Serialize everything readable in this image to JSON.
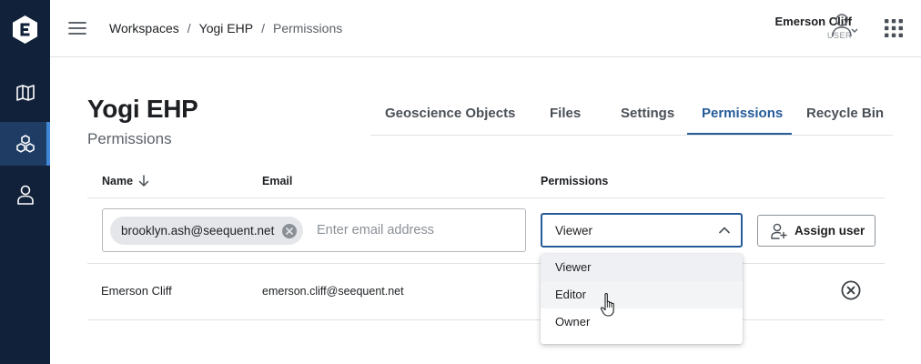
{
  "header": {
    "breadcrumb": [
      "Workspaces",
      "Yogi EHP",
      "Permissions"
    ],
    "separator": "/",
    "user_name": "Emerson Cliff",
    "user_role": "USER"
  },
  "workspace": {
    "title": "Yogi EHP",
    "subtitle": "Permissions"
  },
  "tabs": [
    {
      "label": "Geoscience Objects",
      "active": false
    },
    {
      "label": "Files",
      "active": false
    },
    {
      "label": "Settings",
      "active": false
    },
    {
      "label": "Permissions",
      "active": true
    },
    {
      "label": "Recycle Bin",
      "active": false
    }
  ],
  "table": {
    "columns": [
      "Name",
      "Email",
      "Permissions"
    ],
    "rows": [
      {
        "name": "Emerson Cliff",
        "email": "emerson.cliff@seequent.net"
      }
    ]
  },
  "add_user": {
    "chip": "brooklyn.ash@seequent.net",
    "placeholder": "Enter email address",
    "permission_value": "Viewer",
    "assign_label": "Assign user"
  },
  "dropdown": {
    "options": [
      "Viewer",
      "Editor",
      "Owner"
    ],
    "selected": "Viewer",
    "hovered": "Editor"
  },
  "colors": {
    "sidebar": "#11213a",
    "sidebar_active": "#1f3c64",
    "accent": "#265c99"
  },
  "icons": [
    "logo-icon",
    "map-icon",
    "workspaces-icon",
    "user-icon",
    "hamburger-icon",
    "account-icon",
    "apps-grid-icon",
    "sort-down-icon",
    "chip-remove-icon",
    "chevron-up-icon",
    "add-user-icon",
    "remove-circle-icon"
  ]
}
